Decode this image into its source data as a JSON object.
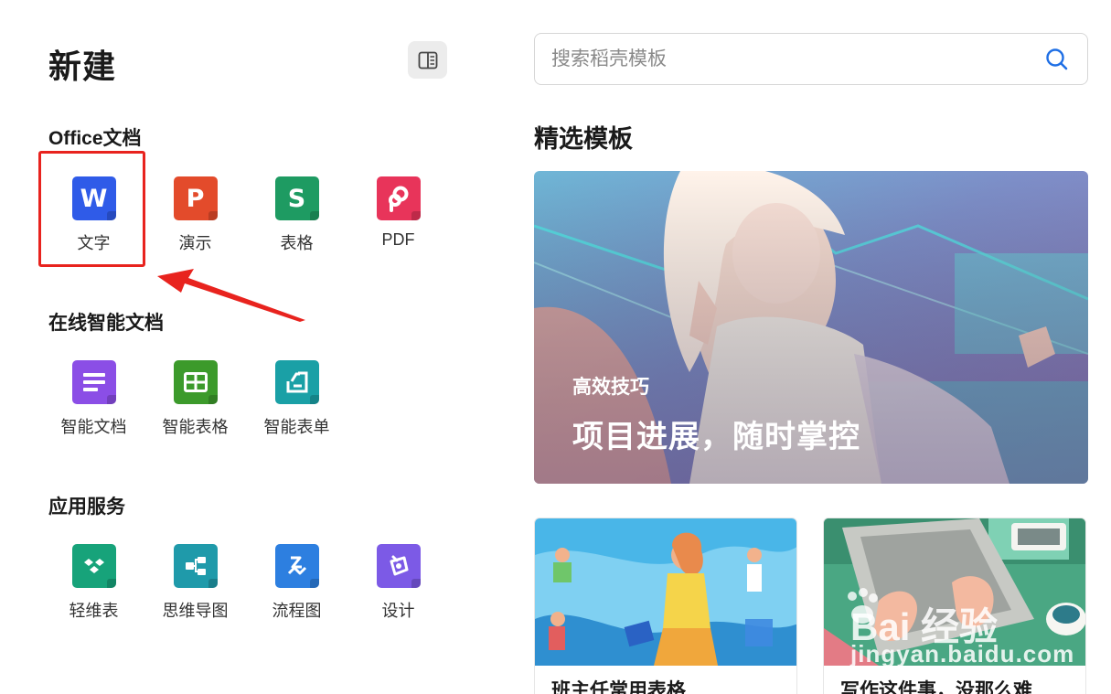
{
  "header": {
    "title": "新建"
  },
  "sections": {
    "office": {
      "title": "Office文档",
      "items": [
        {
          "label": "文字",
          "letter": "W",
          "color": "#2f5be8",
          "icon": "word-icon"
        },
        {
          "label": "演示",
          "letter": "P",
          "color": "#e34b2b",
          "icon": "presentation-icon"
        },
        {
          "label": "表格",
          "letter": "S",
          "color": "#1e9b62",
          "icon": "spreadsheet-icon"
        },
        {
          "label": "PDF",
          "letter": "",
          "color": "#e8345a",
          "icon": "pdf-icon"
        }
      ]
    },
    "online": {
      "title": "在线智能文档",
      "items": [
        {
          "label": "智能文档",
          "color": "#8b4ee6",
          "icon": "smart-doc-icon"
        },
        {
          "label": "智能表格",
          "color": "#3c9a2b",
          "icon": "smart-sheet-icon"
        },
        {
          "label": "智能表单",
          "color": "#1aa0a6",
          "icon": "smart-form-icon"
        }
      ]
    },
    "services": {
      "title": "应用服务",
      "items": [
        {
          "label": "轻维表",
          "color": "#17a37a",
          "icon": "light-table-icon"
        },
        {
          "label": "思维导图",
          "color": "#1f9aaa",
          "icon": "mindmap-icon"
        },
        {
          "label": "流程图",
          "color": "#2d7fe0",
          "icon": "flowchart-icon"
        },
        {
          "label": "设计",
          "color": "#7c5ae6",
          "icon": "design-icon"
        }
      ]
    }
  },
  "search": {
    "placeholder": "搜索稻壳模板"
  },
  "featured": {
    "title": "精选模板",
    "banner": {
      "subtitle": "高效技巧",
      "headline": "项目进展，随时掌控"
    },
    "cards": [
      {
        "title": "班主任常用表格"
      },
      {
        "title": "写作这件事，没那么难"
      }
    ]
  },
  "watermark": {
    "brand": "Bai 经验",
    "url": "jingyan.baidu.com"
  }
}
